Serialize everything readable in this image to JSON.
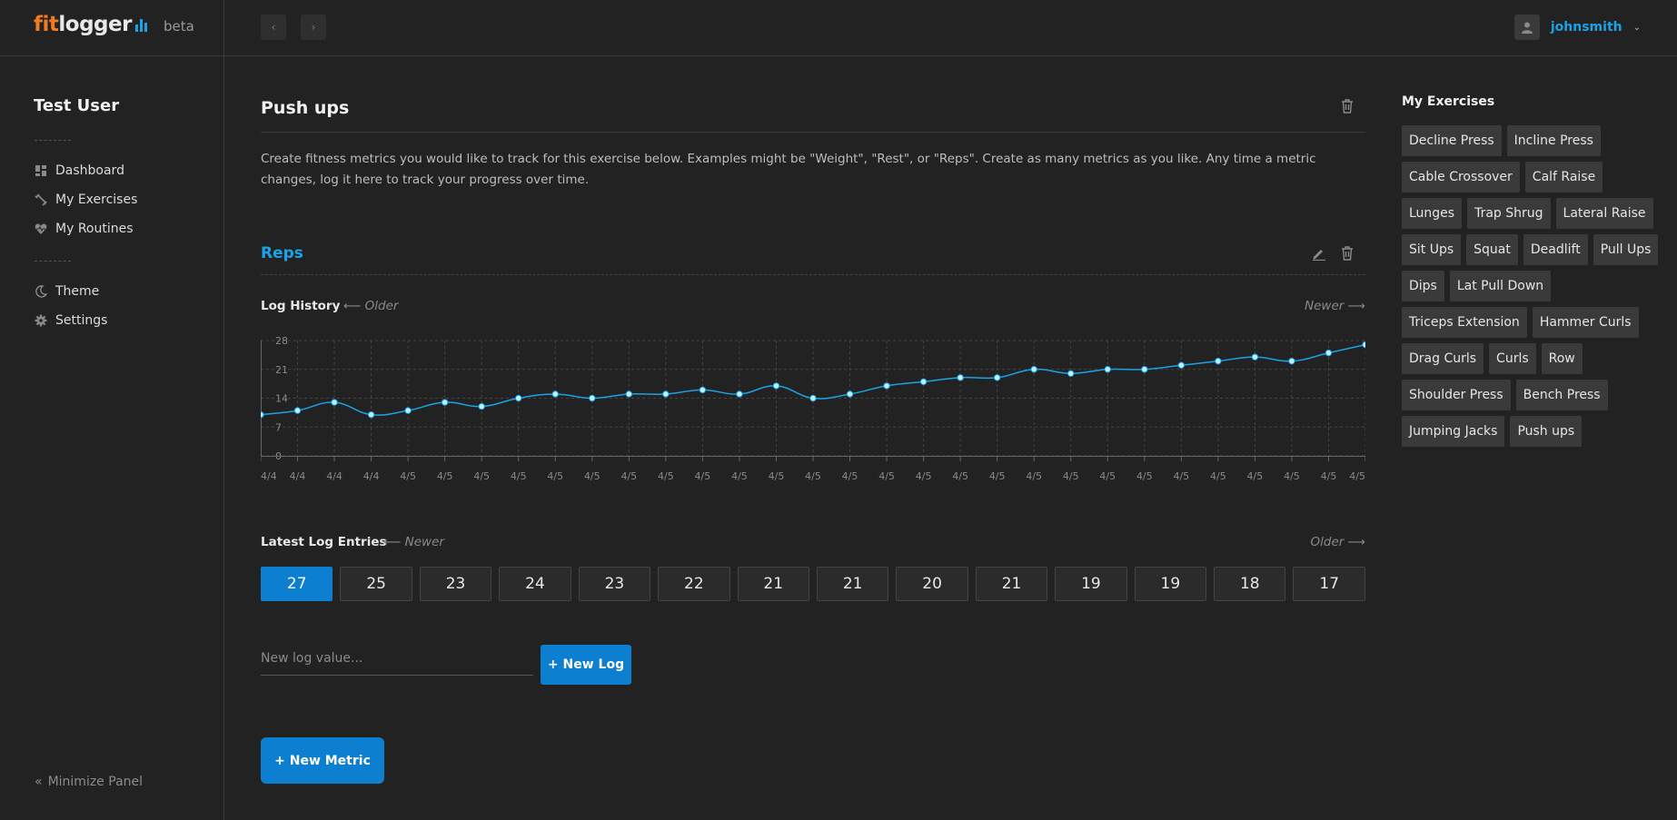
{
  "brand": {
    "fit": "fit",
    "logger": "logger",
    "beta": "beta"
  },
  "header": {
    "username": "johnsmith"
  },
  "sidebar": {
    "user_name": "Test User",
    "items": [
      {
        "label": "Dashboard",
        "icon": "dashboard-icon"
      },
      {
        "label": "My Exercises",
        "icon": "exercise-icon"
      },
      {
        "label": "My Routines",
        "icon": "heart-pulse-icon"
      },
      {
        "label": "Theme",
        "icon": "moon-icon"
      },
      {
        "label": "Settings",
        "icon": "gear-icon"
      }
    ],
    "minimize": "Minimize Panel"
  },
  "exercise": {
    "title": "Push ups",
    "description": "Create fitness metrics you would like to track for this exercise below. Examples might be \"Weight\", \"Rest\", or \"Reps\". Create as many metrics as you like. Any time a metric changes, log it here to track your progress over time."
  },
  "metric": {
    "title": "Reps",
    "log_history_label": "Log History",
    "older_label": "Older",
    "newer_label": "Newer",
    "latest_label": "Latest Log Entries",
    "latest_left": "Newer",
    "latest_right": "Older",
    "entries": [
      "27",
      "25",
      "23",
      "24",
      "23",
      "22",
      "21",
      "21",
      "20",
      "21",
      "19",
      "19",
      "18",
      "17"
    ],
    "new_log_placeholder": "New log value...",
    "new_log_button": "+ New Log",
    "new_metric_button": "+ New Metric"
  },
  "chart_data": {
    "type": "line",
    "x": [
      "4/4",
      "4/4",
      "4/4",
      "4/4",
      "4/5",
      "4/5",
      "4/5",
      "4/5",
      "4/5",
      "4/5",
      "4/5",
      "4/5",
      "4/5",
      "4/5",
      "4/5",
      "4/5",
      "4/5",
      "4/5",
      "4/5",
      "4/5",
      "4/5",
      "4/5",
      "4/5",
      "4/5",
      "4/5",
      "4/5",
      "4/5",
      "4/5",
      "4/5",
      "4/5",
      "4/5"
    ],
    "values": [
      10,
      11,
      13,
      10,
      11,
      13,
      12,
      14,
      15,
      14,
      15,
      15,
      16,
      15,
      17,
      14,
      15,
      17,
      18,
      19,
      19,
      21,
      20,
      21,
      21,
      22,
      23,
      24,
      23,
      25,
      27
    ],
    "yticks": [
      0,
      7,
      14,
      21,
      28
    ],
    "ylim": [
      0,
      28
    ],
    "grid": true,
    "color": "#1aa3e8",
    "point_color": "#bff4ff"
  },
  "my_exercises": {
    "title": "My Exercises",
    "items": [
      "Decline Press",
      "Incline Press",
      "Cable Crossover",
      "Calf Raise",
      "Lunges",
      "Trap Shrug",
      "Lateral Raise",
      "Sit Ups",
      "Squat",
      "Deadlift",
      "Pull Ups",
      "Dips",
      "Lat Pull Down",
      "Triceps Extension",
      "Hammer Curls",
      "Drag Curls",
      "Curls",
      "Row",
      "Shoulder Press",
      "Bench Press",
      "Jumping Jacks",
      "Push ups"
    ]
  }
}
